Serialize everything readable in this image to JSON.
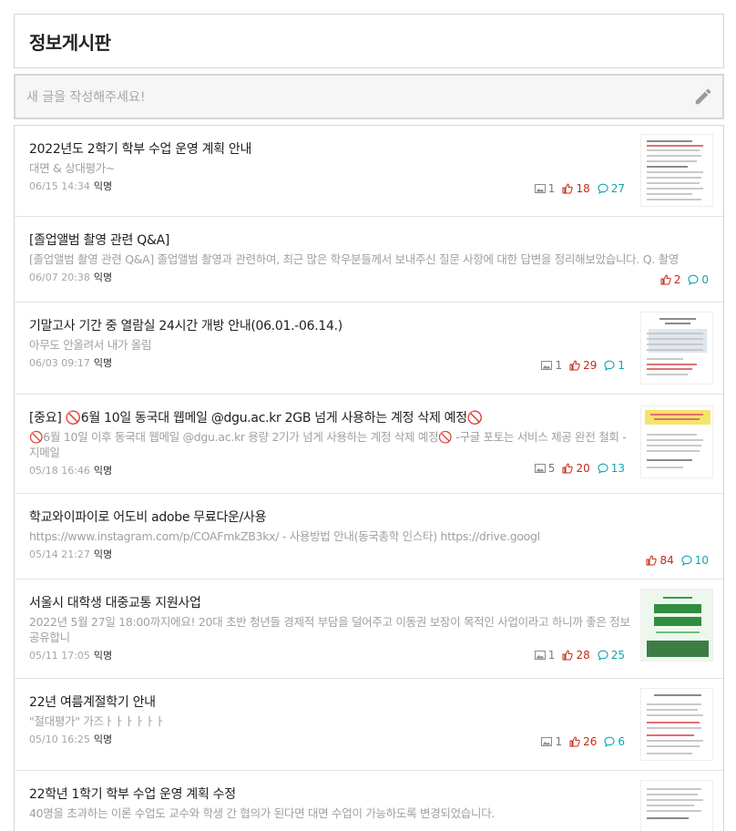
{
  "board": {
    "title": "정보게시판"
  },
  "compose": {
    "placeholder": "새 글을 작성해주세요!"
  },
  "colors": {
    "like": "#c62917",
    "comment": "#0ca5af",
    "image": "#7a7a7a"
  },
  "posts": [
    {
      "title": "2022년도 2학기 학부 수업 운영 계획 안내",
      "body": "대면 & 상대평가~",
      "time": "06/15 14:34",
      "author": "익명",
      "images": "1",
      "likes": "18",
      "comments": "27",
      "thumbnail": true
    },
    {
      "title": "[졸업앨범 촬영 관련 Q&A]",
      "body": "[졸업앨범 촬영 관련 Q&A] 졸업앨범 촬영과 관련하여, 최근 많은 학우분들께서 보내주신 질문 사항에 대한 답변을 정리해보았습니다. Q. 촬영",
      "time": "06/07 20:38",
      "author": "익명",
      "images": "",
      "likes": "2",
      "comments": "0",
      "thumbnail": false
    },
    {
      "title": "기말고사 기간 중 열람실 24시간 개방 안내(06.01.-06.14.)",
      "body": "아무도 안올려서 내가 올림",
      "time": "06/03 09:17",
      "author": "익명",
      "images": "1",
      "likes": "29",
      "comments": "1",
      "thumbnail": true
    },
    {
      "title": "[중요] 🚫6월 10일 동국대 웹메일 @dgu.ac.kr 2GB 넘게 사용하는 계정 삭제 예정🚫",
      "body": "🚫6월 10일 이후 동국대 웹메일 @dgu.ac.kr 용량 2기가 넘게 사용하는 계정 삭제 예정🚫 -구글 포토는 서비스 제공 완전 철회 - 지메일",
      "time": "05/18 16:46",
      "author": "익명",
      "images": "5",
      "likes": "20",
      "comments": "13",
      "thumbnail": true
    },
    {
      "title": "학교와이파이로 어도비 adobe 무료다운/사용",
      "body": "https://www.instagram.com/p/COAFmkZB3kx/ - 사용방법 안내(동국총학 인스타) https://drive.googl",
      "time": "05/14 21:27",
      "author": "익명",
      "images": "",
      "likes": "84",
      "comments": "10",
      "thumbnail": false
    },
    {
      "title": "서울시 대학생 대중교통 지원사업",
      "body": "2022년 5월 27일 18:00까지에요! 20대 초반 청년들 경제적 부담을 덜어주고 이동권 보장이 목적인 사업이라고 하니까 좋은 정보 공유합니",
      "time": "05/11 17:05",
      "author": "익명",
      "images": "1",
      "likes": "28",
      "comments": "25",
      "thumbnail": true
    },
    {
      "title": "22년 여름계절학기 안내",
      "body": "\"절대평가\" 가즈ㅏㅏㅏㅏㅏㅏ",
      "time": "05/10 16:25",
      "author": "익명",
      "images": "1",
      "likes": "26",
      "comments": "6",
      "thumbnail": true
    },
    {
      "title": "22학년 1학기 학부 수업 운영 계획 수정",
      "body": "40명을 초과하는 이론 수업도 교수와 학생 간 협의가 된다면 대면 수업이 가능하도록 변경되었습니다.",
      "time": "",
      "author": "",
      "images": "",
      "likes": "",
      "comments": "",
      "thumbnail": true
    }
  ]
}
